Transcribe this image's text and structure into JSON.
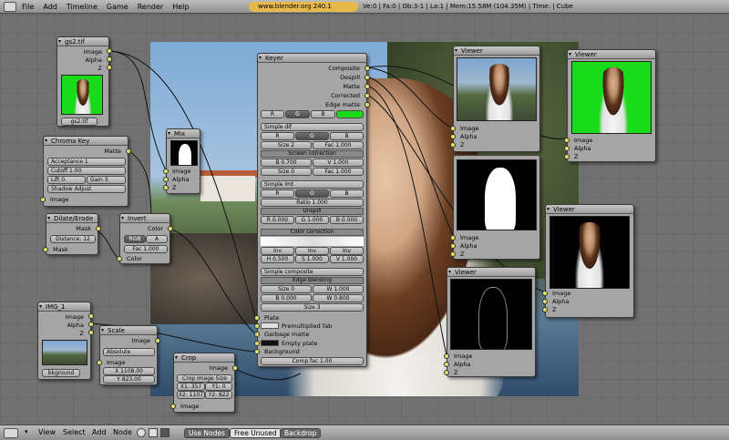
{
  "topbar": {
    "menu": [
      "File",
      "Add",
      "Timeline",
      "Game",
      "Render",
      "Help"
    ],
    "url": "www.blender.org 240.1",
    "stats": "Ve:0 | Fa:0 | Ob:3-1 | La:1 | Mem:15.58M (104.35M) | Time: | Cube"
  },
  "nodes": {
    "gs2": {
      "title": "gs2.tif",
      "outputs": [
        "Image",
        "Alpha",
        "Z"
      ],
      "file": "gs2.tif"
    },
    "chroma": {
      "title": "Chroma Key",
      "output": "Matte",
      "fields": [
        "Acceptance 1",
        "Cutoff 1.00",
        "Lift 0.",
        "Gain 3",
        "Shadow Adjust"
      ],
      "input": "Image"
    },
    "mix": {
      "title": "Mix",
      "outputs": [
        "Image",
        "Alpha",
        "Z"
      ]
    },
    "dilate": {
      "title": "Dilate/Erode",
      "output": "Mask",
      "field": "Distance: 12",
      "input": "Mask"
    },
    "invert": {
      "title": "Invert",
      "output": "Color",
      "buttons": [
        "RGB",
        "A"
      ],
      "fac": "Fac 1.000",
      "input": "Color"
    },
    "keyer": {
      "title": "Keyer",
      "outputs": [
        "Composite",
        "Despill",
        "Matte",
        "Corrected",
        "Edge matte"
      ],
      "channels": [
        "R",
        "G",
        "B"
      ],
      "sections": {
        "simple_dif": "Simple dif",
        "size2": "Size 2",
        "fac1": "Fac 1.000",
        "screen_corr": "Screen correction",
        "b0700": "B 0.700",
        "v1000": "V 1.000",
        "size0": "Size 0",
        "fac1b": "Fac 1.000",
        "simple_lmt": "Simple lmt",
        "ratio": "Ratio 1.000",
        "unspill": "Unspill",
        "r0": "R 0.000",
        "g1": "G 1.000",
        "b0": "B 0.000",
        "color_corr": "Color correction",
        "inv": "Inv",
        "h0500": "H 0.500",
        "s1000": "S 1.000",
        "v1000b": "V 1.000",
        "simple_comp": "Simple composite",
        "edge_blend": "Edge blending",
        "size0b": "Size 0",
        "w1000": "W 1.000",
        "b0000": "B 0.000",
        "w0800": "W 0.800",
        "size3": "Size 3"
      },
      "inputs": [
        "Plate",
        "Premultiplied fab",
        "Garbage matte",
        "Empty plate",
        "Background"
      ],
      "comp": "Comp fac 1.00"
    },
    "viewer_titles": [
      "Viewer",
      "Viewer",
      "Viewer",
      "Viewer"
    ],
    "viewer_inputs": [
      "Image",
      "Alpha",
      "Z"
    ],
    "img1": {
      "title": "IMG_1",
      "outputs": [
        "Image",
        "Alpha",
        "Z"
      ],
      "file": "bkground"
    },
    "scale": {
      "title": "Scale",
      "output": "Image",
      "mode": "Absolute",
      "input": "Image",
      "x": "X 1108.00",
      "y": "Y 823.00"
    },
    "crop": {
      "title": "Crop",
      "output": "Image",
      "button": "Crop Image Size",
      "x1": "X1: 357",
      "y1": "Y1: 0",
      "x2": "X2: 1107",
      "y2": "Y2: 822",
      "input": "Image"
    }
  },
  "bottombar": {
    "menu": [
      "View",
      "Select",
      "Add",
      "Node"
    ],
    "buttons": [
      "Use Nodes",
      "Free Unused",
      "Backdrop"
    ]
  },
  "colors": {
    "socket": "#e3e06a",
    "green_key": "#1adb1a",
    "url_bg": "#e7b84a"
  }
}
